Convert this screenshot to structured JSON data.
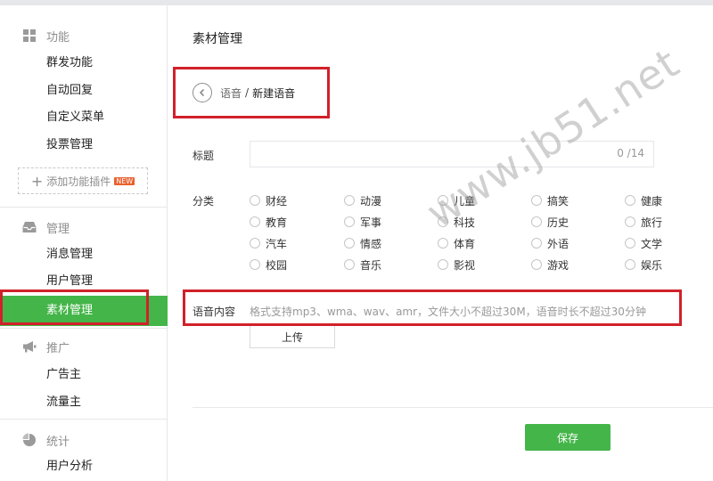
{
  "sidebar": {
    "sections": [
      {
        "name": "功能",
        "icon": "grid-icon"
      },
      {
        "name": "管理",
        "icon": "inbox-icon"
      },
      {
        "name": "推广",
        "icon": "megaphone-icon"
      },
      {
        "name": "统计",
        "icon": "pie-chart-icon"
      }
    ],
    "features": [
      "群发功能",
      "自动回复",
      "自定义菜单",
      "投票管理"
    ],
    "plugin_button": "添加功能插件",
    "plugin_badge": "NEW",
    "manage": [
      "消息管理",
      "用户管理",
      "素材管理"
    ],
    "promote": [
      "广告主",
      "流量主"
    ],
    "stats": [
      "用户分析"
    ],
    "active_item": "素材管理"
  },
  "main": {
    "title": "素材管理",
    "breadcrumb": {
      "parent": "语音",
      "separator": "/",
      "current": "新建语音"
    },
    "form": {
      "title_label": "标题",
      "title_value": "",
      "title_counter": "0 /14",
      "category_label": "分类",
      "categories": [
        [
          "财经",
          "动漫",
          "儿童",
          "搞笑",
          "健康"
        ],
        [
          "教育",
          "军事",
          "科技",
          "历史",
          "旅行"
        ],
        [
          "汽车",
          "情感",
          "体育",
          "外语",
          "文学"
        ],
        [
          "校园",
          "音乐",
          "影视",
          "游戏",
          "娱乐"
        ]
      ],
      "voice_label": "语音内容",
      "voice_hint": "格式支持mp3、wma、wav、amr，文件大小不超过30M，语音时长不超过30分钟",
      "upload_button": "上传",
      "save_button": "保存"
    }
  },
  "watermark": "www.jb51.net",
  "colors": {
    "accent": "#44b549",
    "highlight": "#d1212a",
    "sidebar_border": "#e7e7eb",
    "badge": "#e9612d"
  }
}
